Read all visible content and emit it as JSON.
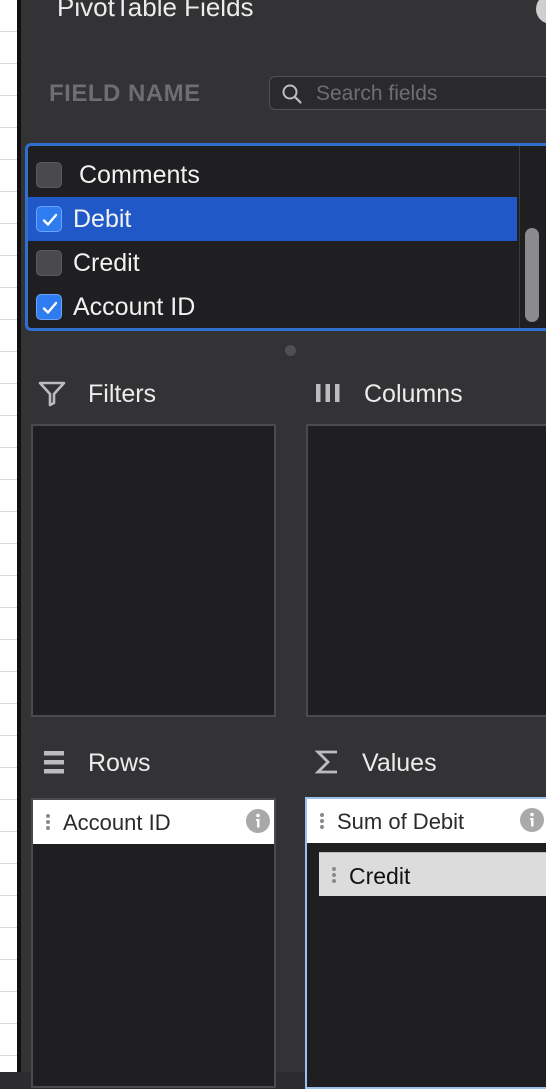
{
  "panel": {
    "title": "PivotTable Fields",
    "close_icon": "close-icon"
  },
  "fields": {
    "header": "FIELD NAME",
    "search": {
      "placeholder": "Search fields",
      "value": ""
    },
    "items": [
      {
        "label": "Comments",
        "checked": false,
        "selected": false
      },
      {
        "label": "Debit",
        "checked": true,
        "selected": true
      },
      {
        "label": "Credit",
        "checked": false,
        "selected": false
      },
      {
        "label": "Account ID",
        "checked": true,
        "selected": false
      }
    ]
  },
  "areas": {
    "filters": {
      "title": "Filters",
      "icon": "filter-icon",
      "items": []
    },
    "columns": {
      "title": "Columns",
      "icon": "columns-icon",
      "items": []
    },
    "rows": {
      "title": "Rows",
      "icon": "rows-icon",
      "items": [
        {
          "label": "Account ID"
        }
      ]
    },
    "values": {
      "title": "Values",
      "icon": "sigma-icon",
      "items": [
        {
          "label": "Sum of Debit"
        }
      ],
      "dragging_item": {
        "label": "Credit"
      }
    }
  },
  "colors": {
    "panel_bg": "#333335",
    "list_bg": "#1f1f21",
    "selection": "#2158c8",
    "focus_border": "#2f6fd0",
    "checkbox_checked": "#2f7bf0"
  }
}
